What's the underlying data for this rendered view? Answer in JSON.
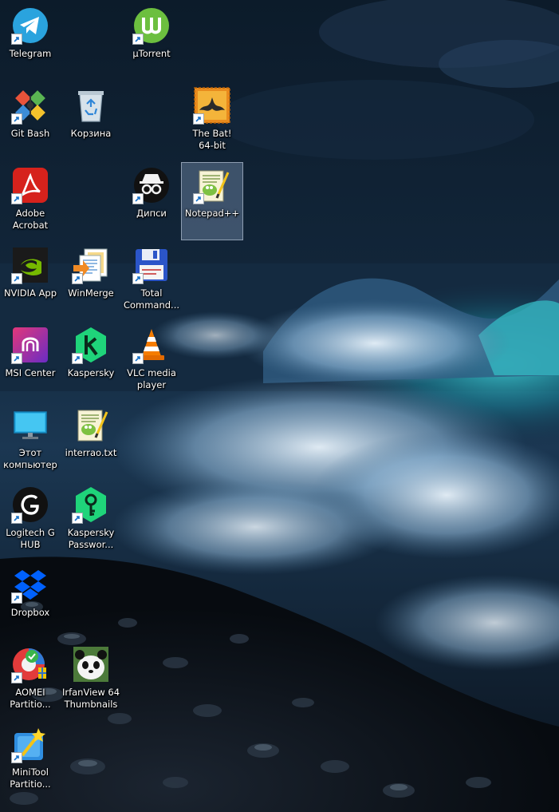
{
  "desktop": {
    "icons": [
      {
        "id": "telegram",
        "label": "Telegram",
        "shortcut": true
      },
      {
        "id": "utorrent",
        "label": "µTorrent",
        "shortcut": true
      },
      {
        "id": "gitbash",
        "label": "Git Bash",
        "shortcut": true
      },
      {
        "id": "recycle",
        "label": "Корзина",
        "shortcut": false
      },
      {
        "id": "thebat",
        "label": "The Bat!\n64-bit",
        "shortcut": true
      },
      {
        "id": "acrobat",
        "label": "Adobe\nAcrobat",
        "shortcut": true
      },
      {
        "id": "dipsy",
        "label": "Дипси",
        "shortcut": true
      },
      {
        "id": "notepadpp",
        "label": "Notepad++",
        "shortcut": true,
        "selected": true
      },
      {
        "id": "nvidia",
        "label": "NVIDIA App",
        "shortcut": true
      },
      {
        "id": "winmerge",
        "label": "WinMerge",
        "shortcut": true
      },
      {
        "id": "totalcmd",
        "label": "Total\nCommand...",
        "shortcut": true
      },
      {
        "id": "msi",
        "label": "MSI Center",
        "shortcut": true
      },
      {
        "id": "kaspersky",
        "label": "Kaspersky",
        "shortcut": true
      },
      {
        "id": "vlc",
        "label": "VLC media\nplayer",
        "shortcut": true
      },
      {
        "id": "thispc",
        "label": "Этот\nкомпьютер",
        "shortcut": false
      },
      {
        "id": "interrao",
        "label": "interrao.txt",
        "shortcut": false
      },
      {
        "id": "logitech",
        "label": "Logitech G\nHUB",
        "shortcut": true
      },
      {
        "id": "kpass",
        "label": "Kaspersky\nPasswor...",
        "shortcut": true
      },
      {
        "id": "dropbox",
        "label": "Dropbox",
        "shortcut": true
      },
      {
        "id": "aomei",
        "label": "AOMEI\nPartitio...",
        "shortcut": true
      },
      {
        "id": "irfanview",
        "label": "IrfanView 64\nThumbnails",
        "shortcut": false
      },
      {
        "id": "minitool",
        "label": "MiniTool\nPartitio...",
        "shortcut": true
      }
    ]
  },
  "icon_names": {
    "telegram": "telegram-icon",
    "utorrent": "utorrent-icon",
    "gitbash": "git-bash-icon",
    "recycle": "recycle-bin-icon",
    "thebat": "the-bat-icon",
    "acrobat": "adobe-acrobat-icon",
    "dipsy": "dipsy-icon",
    "notepadpp": "notepad-plus-plus-icon",
    "nvidia": "nvidia-icon",
    "winmerge": "winmerge-icon",
    "totalcmd": "total-commander-icon",
    "msi": "msi-center-icon",
    "kaspersky": "kaspersky-icon",
    "vlc": "vlc-icon",
    "thispc": "this-pc-icon",
    "interrao": "text-file-icon",
    "logitech": "logitech-g-hub-icon",
    "kpass": "kaspersky-password-icon",
    "dropbox": "dropbox-icon",
    "aomei": "aomei-icon",
    "irfanview": "irfanview-icon",
    "minitool": "minitool-icon"
  },
  "colors": {
    "label_text": "#ffffff",
    "selection": "#a0b9dc"
  }
}
